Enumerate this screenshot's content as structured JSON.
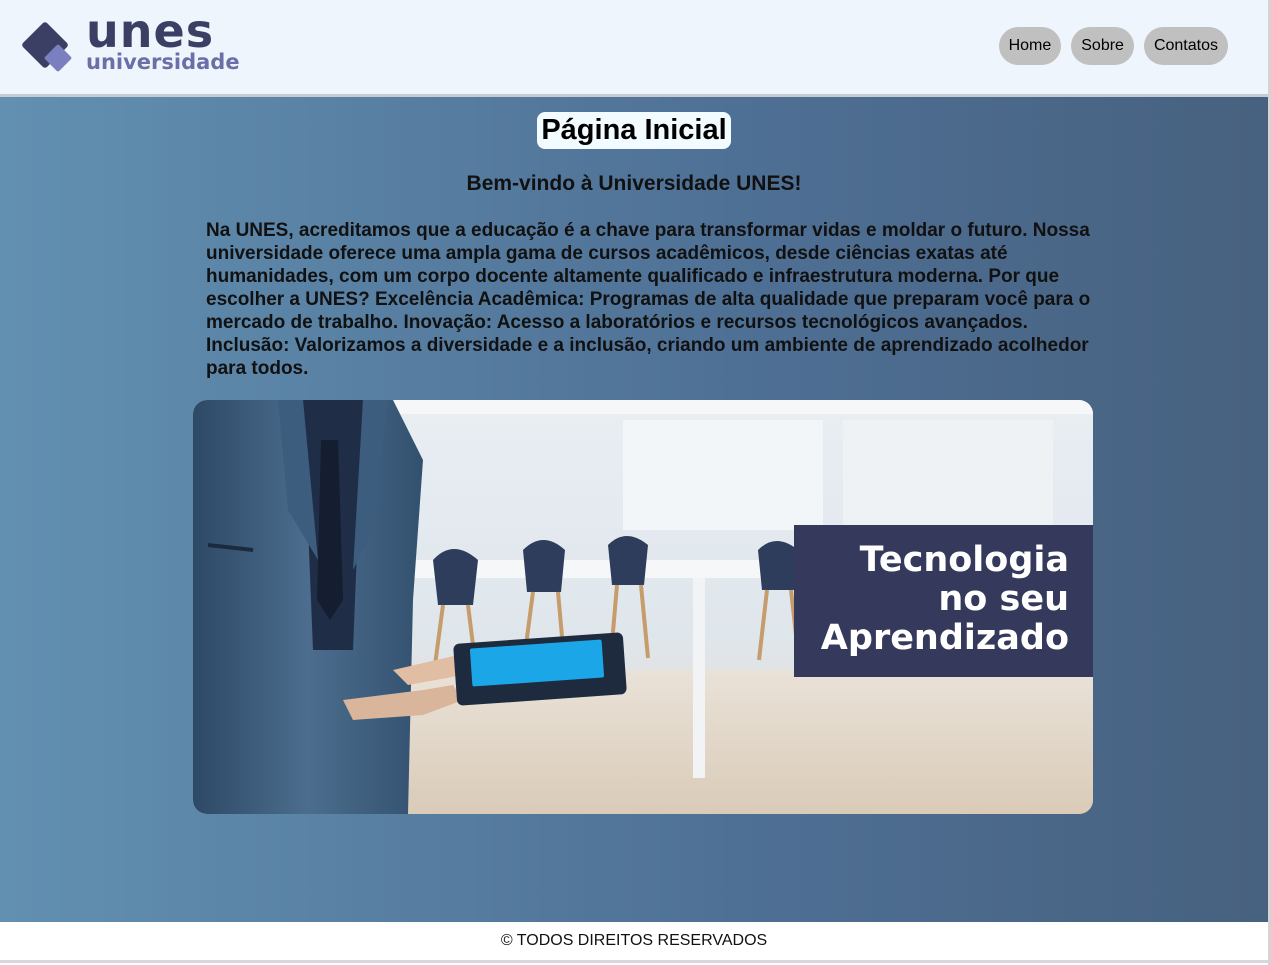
{
  "logo": {
    "name": "unes",
    "subtitle": "universidade"
  },
  "nav": {
    "items": [
      {
        "label": "Home"
      },
      {
        "label": "Sobre"
      },
      {
        "label": "Contatos"
      }
    ]
  },
  "main": {
    "title": "Página Inicial",
    "welcome": "Bem-vindo à Universidade UNES!",
    "intro": "Na UNES, acreditamos que a educação é a chave para transformar vidas e moldar o futuro. Nossa universidade oferece uma ampla gama de cursos acadêmicos, desde ciências exatas até humanidades, com um corpo docente altamente qualificado e infraestrutura moderna. Por que escolher a UNES? Excelência Acadêmica: Programas de alta qualidade que preparam você para o mercado de trabalho. Inovação: Acesso a laboratórios e recursos tecnológicos avançados. Inclusão: Valorizamos a diversidade e a inclusão, criando um ambiente de aprendizado acolhedor para todos.",
    "hero": {
      "caption_lines": [
        "Tecnologia",
        "no seu",
        "Aprendizado"
      ]
    }
  },
  "footer": {
    "text": "© TODOS DIREITOS RESERVADOS"
  },
  "colors": {
    "brand_dark": "#3a3f63",
    "brand_light": "#6b6fa8",
    "nav_button": "#c0c0c0",
    "caption_bg": "#353a5c"
  }
}
